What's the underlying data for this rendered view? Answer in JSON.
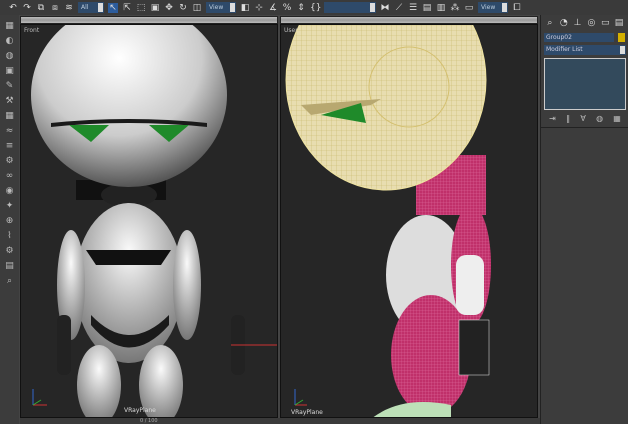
{
  "toolbar": {
    "selection_filter": "All",
    "reference_coord": "View",
    "named_selection": "",
    "view_dropdown": "View",
    "icons": [
      "undo-icon",
      "redo-icon",
      "link-icon",
      "unlink-icon",
      "bind-space-warp-icon",
      "select-icon",
      "select-by-name-icon",
      "rect-selection-icon",
      "window-crossing-icon",
      "move-icon",
      "rotate-icon",
      "scale-icon",
      "pivot-icon",
      "mirror-icon",
      "snap-toggle-icon",
      "angle-snap-icon",
      "percent-snap-icon",
      "spinner-snap-icon",
      "edit-named-selection-icon",
      "mirror-tool-icon",
      "align-icon",
      "layer-manager-icon",
      "curve-editor-icon",
      "schematic-view-icon",
      "material-editor-icon",
      "render-setup-icon",
      "render-frame-icon",
      "render-icon"
    ]
  },
  "viewports": [
    {
      "label": "Front",
      "plane_label": "VRayPlane"
    },
    {
      "label": "User",
      "plane_label": "VRayPlane"
    }
  ],
  "command_panel": {
    "tabs": [
      "create-icon",
      "modify-icon",
      "hierarchy-icon",
      "motion-icon",
      "display-icon",
      "utilities-icon"
    ],
    "object_name": "Group02",
    "object_color": "#d4b000",
    "modifier_list": "Modifier List",
    "stack_buttons": [
      "pin-stack-icon",
      "show-end-result-icon",
      "make-unique-icon",
      "remove-modifier-icon",
      "configure-modifier-sets-icon"
    ]
  },
  "status": {
    "value": "0 / 100"
  },
  "colors": {
    "viewport_bg": "#262626",
    "wire_yellow": "#f0e4a0",
    "wire_magenta": "#c0306a",
    "eye_green": "#1f8a2a"
  }
}
